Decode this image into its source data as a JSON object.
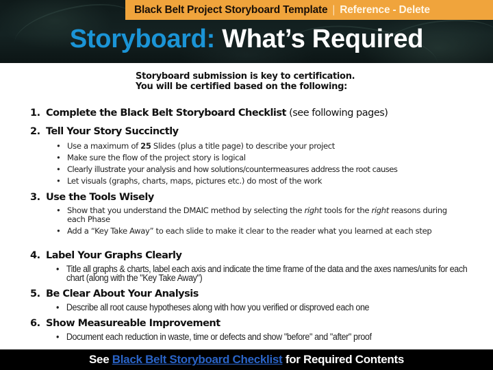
{
  "header": {
    "template_title": "Black Belt Project Storyboard Template",
    "separator": "|",
    "reference_label": "Reference - Delete",
    "title_accent": "Storyboard:",
    "title_rest": "What’s Required"
  },
  "intro": {
    "line1": "Storyboard submission is key to certification.",
    "line2": "You will be certified based on the following:"
  },
  "items": [
    {
      "number": "1.",
      "heading": "Complete the Black Belt Storyboard Checklist",
      "heading_suffix": " (see following pages)"
    },
    {
      "number": "2.",
      "heading": "Tell Your Story Succinctly",
      "bullets": [
        {
          "pre": "Use a maximum of ",
          "bold": "25",
          "post": " Slides (plus a title page) to describe your project"
        },
        {
          "text": "Make sure the flow of the project story is logical"
        },
        {
          "text": "Clearly illustrate your analysis and how solutions/countermeasures address the root causes"
        },
        {
          "text": "Let visuals (graphs, charts, maps, pictures etc.) do most of the work"
        }
      ]
    },
    {
      "number": "3.",
      "heading": "Use the Tools Wisely",
      "bullets": [
        {
          "a": "Show that you understand the DMAIC method by selecting the ",
          "i1": "right",
          "b": " tools for the ",
          "i2": "right",
          "c": " reasons during each Phase"
        },
        {
          "text": "Add a “Key Take Away” to each slide to make it clear to the reader what you learned at each step"
        }
      ]
    },
    {
      "number": "4.",
      "heading": "Label Your Graphs Clearly",
      "bullets": [
        {
          "text": "Title all graphs & charts, label each axis and indicate the time frame of the data and the axes names/units for each chart (along with the \"Key Take Away\")"
        }
      ]
    },
    {
      "number": "5.",
      "heading": "Be Clear About Your Analysis",
      "bullets": [
        {
          "text": "Describe all root cause hypotheses along with how you verified or disproved each one"
        }
      ]
    },
    {
      "number": "6.",
      "heading": "Show Measureable Improvement",
      "bullets": [
        {
          "text": "Document each reduction in waste, time or defects and show \"before\" and \"after\" proof"
        }
      ]
    }
  ],
  "bullet_glyph": "•",
  "footer": {
    "pre": "See ",
    "link": "Black Belt Storyboard Checklist",
    "post": " for Required Contents"
  }
}
